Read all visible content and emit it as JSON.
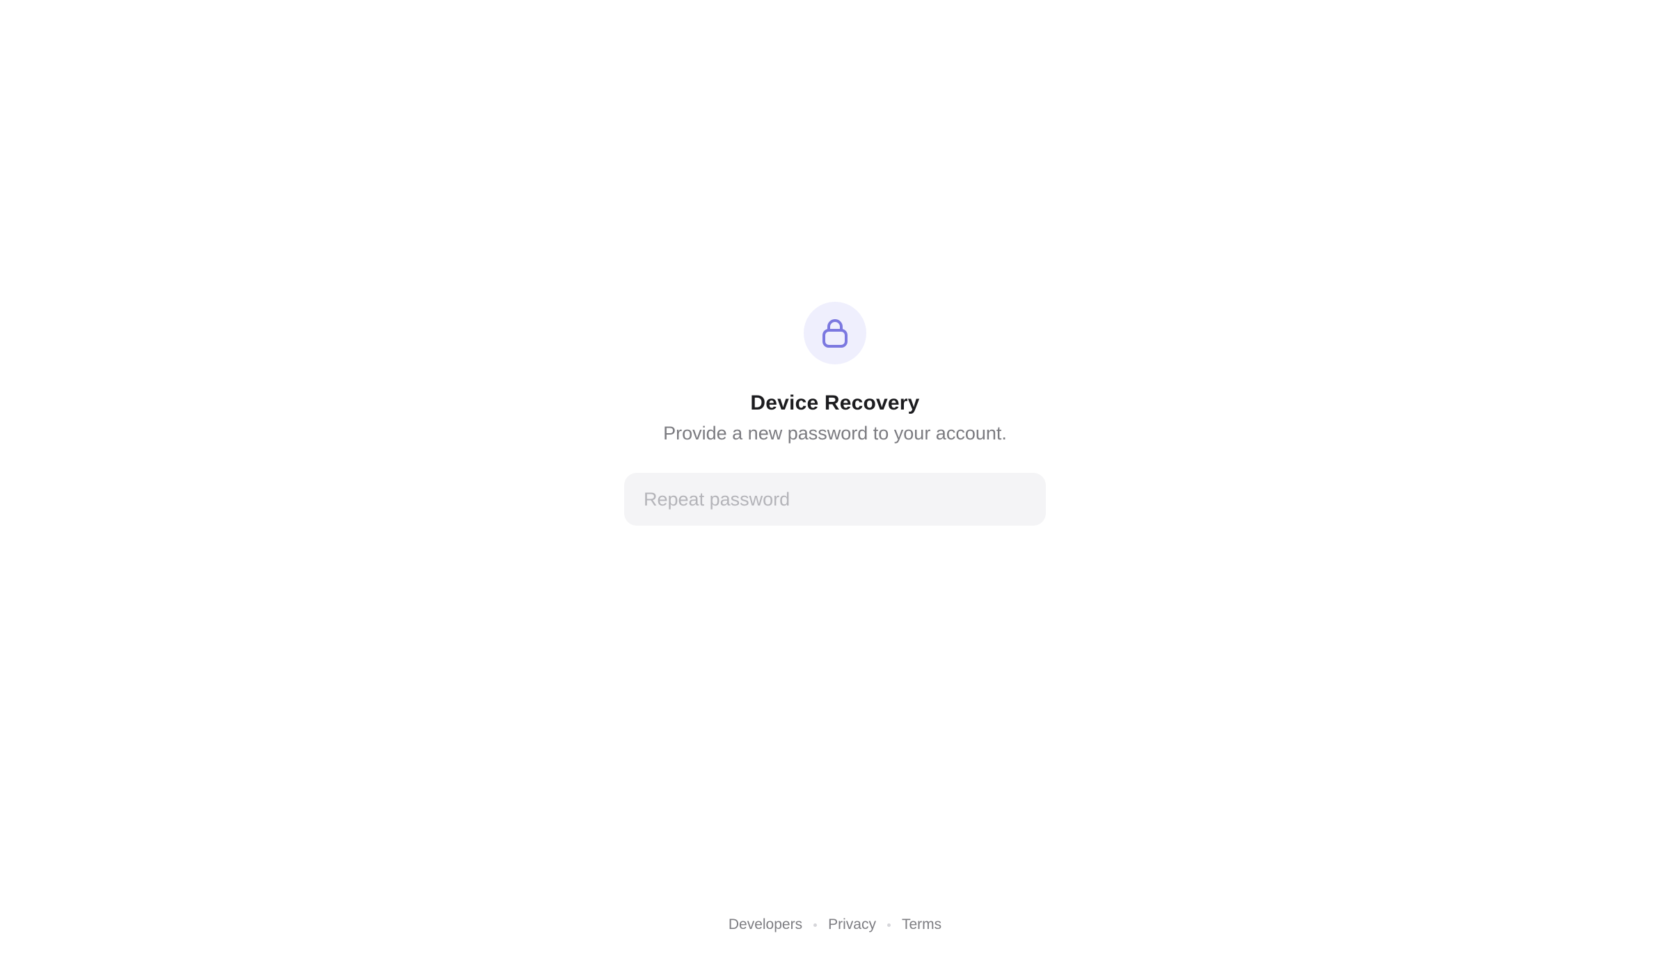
{
  "header": {
    "icon": "lock-icon",
    "title": "Device Recovery",
    "subtitle": "Provide a new password to your account."
  },
  "form": {
    "repeat_password": {
      "value": "",
      "placeholder": "Repeat password"
    }
  },
  "footer": {
    "links": [
      "Developers",
      "Privacy",
      "Terms"
    ]
  },
  "colors": {
    "accent": "#7b78e0",
    "icon_bg": "#efeffd",
    "input_bg": "#f4f4f6"
  }
}
